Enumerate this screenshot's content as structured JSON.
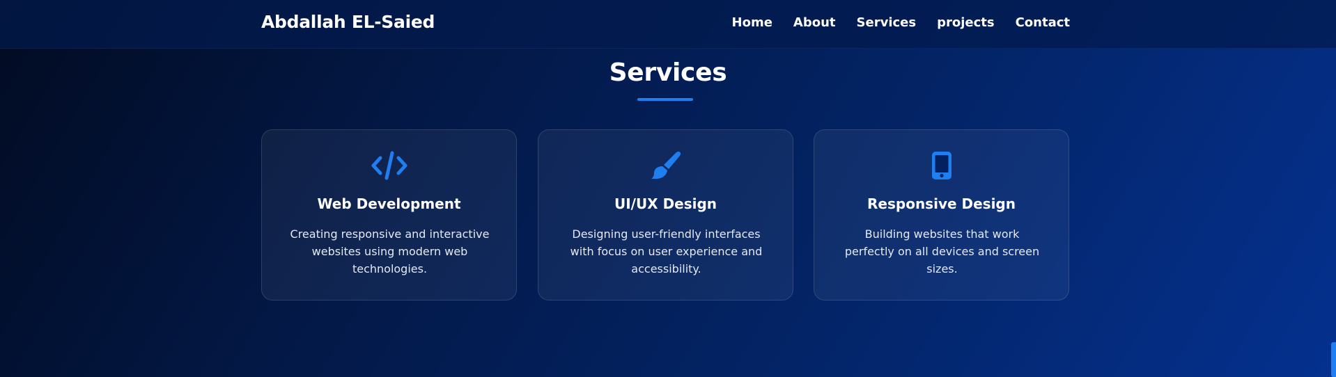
{
  "navbar": {
    "brand": "Abdallah EL-Saied",
    "links": [
      "Home",
      "About",
      "Services",
      "projects",
      "Contact"
    ]
  },
  "services": {
    "title": "Services",
    "cards": [
      {
        "icon": "code-icon",
        "title": "Web Development",
        "description": "Creating responsive and interactive websites using modern web technologies."
      },
      {
        "icon": "paint-brush-icon",
        "title": "UI/UX Design",
        "description": "Designing user-friendly interfaces with focus on user experience and accessibility."
      },
      {
        "icon": "mobile-phone-icon",
        "title": "Responsive Design",
        "description": "Building websites that work perfectly on all devices and screen sizes."
      }
    ]
  },
  "colors": {
    "accent": "#1f7ef0",
    "background_dark": "#020b22",
    "background_light": "#04318f"
  }
}
